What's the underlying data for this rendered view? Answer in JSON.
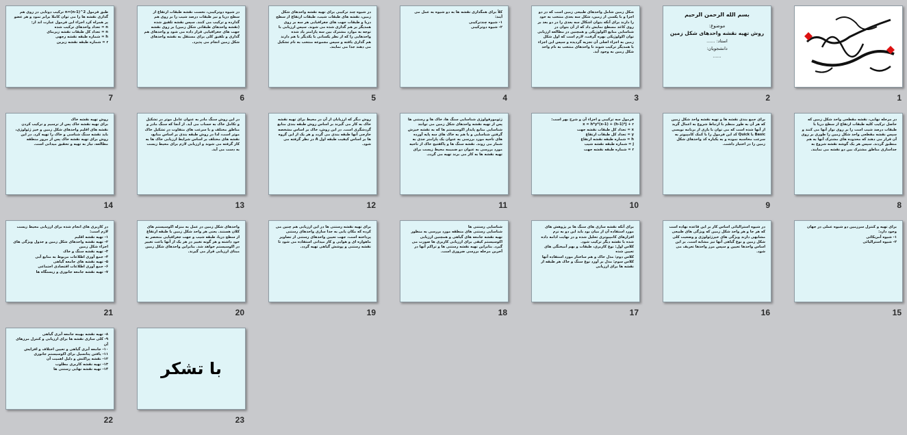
{
  "slides": [
    {
      "n": "1",
      "type": "calligraphy"
    },
    {
      "n": "2",
      "type": "title",
      "l1": "بسم الله الرحمن الرحیم",
      "l2": "موضوع:",
      "l3": "روش تهیه نقشه واحدهای شکل زمین",
      "l4": "استاد: ......",
      "l5": "دانشجویان:",
      "l6": "......"
    },
    {
      "n": "3",
      "type": "text",
      "text": "شکل زمین شامل واحدهای طبیعی زمین است که در دو اجزا و با یکسی از زمین، شکل سه بعدی منتخب به خود را دارند برای آنکه بتوان اشکال سه بعدی را در دو بعد بر روی کاغذ مسطح نمایش داد که از آن بتوان در شناسایی منابع اکولوژیکی و همچنین در مطالعه ارزیابی توان اکولوژیکی بهره گرفت، لازم است که اول شکل زمین به اجزاء اصلی آن تجزیه گردیده و سپس این اجزاء با همدیگر ترکیب شوند تا واحدهای منتخب به نام واحد شکل زمین به وجود آید."
    },
    {
      "n": "4",
      "type": "text",
      "text": "کلاً برای همگذاری نقشه ها به دو شیوه به عمل می آیند:\n۱- شیوه چندترکیبی\n۲- شیوه دوترکیبی"
    },
    {
      "n": "5",
      "type": "text",
      "text": "در شیوه چند ترکیبی برای تهیه نقشه واحدهای شکل زمین، نقشه های طبقات شیب، طبقات ارتفاع از سطح دریا و طبقات جهت های جغرافیایی هر سه بر روی همدیگر بر هم گذاری شده می شوند. سپس ارزیابی با توجه به موارد مشترک بین سه پارامتر یاد شده واحدهایی را که از نظر یکسانی با یکدیگر با هم دارند هم گذاری یافته و سپس مجموعه منتخب به نام تشکیل می دهند جدا می نمایند."
    },
    {
      "n": "6",
      "type": "text",
      "text": "در شیوه دوترکیبی، نخست نقشه طبقات ارتفاع از سطح دریا و نیز طبقات درصد شیب را بر روی هم گذارده و ترکیب می کنند. سپس نقشه تلفیق شده (نقشه واحدهای طبقاتی شکل زمین) بر روی نقشه جهت های جغرافیایی قرار داده می شود و واحدهای هم گذاری و تلفیق کلی برای مستقل به نقشه واحدهای شکل زمین انجام می پذیرد."
    },
    {
      "n": "7",
      "type": "text",
      "text": "طبق فرمول n=(n-1)^2 ترکیب دوتایی در روی هم گذاری نقشه ها را می توان کاملا برابر نمود و هر عضو پر همراه کرد اجزاء این فرمول عبارت اند از:\nn = تعداد واحدهای ترکیب شده\nn = تعداد کل طبقات نقشه زیربنای\nh = شماره طبقه نقشه رجهی\nr = شماره طبقه نقشه زیرین"
    },
    {
      "n": "8",
      "type": "text",
      "text": "در مرحله نهایی، نقشه مقطعی واحد شکل زمین که حاصل ترکیب کلیه طبقات ارتفاع از سطح دریا با طبقات درصد شیب است را بر روی نوار آنها می کنند و سپس نقشه مقطعی واحد شکل زمین را طوری بر روی آن قرار می دهند که محدوده های مشترک آنها به هم منطبق گردند. سپس هر یک گوشه نقشه شروع به جداسازی مناطق مشترک بین دو نقشه می نمایند."
    },
    {
      "n": "9",
      "type": "text",
      "text": "برای جمع بندی نقشه ها و تهیه نقشه واحد شکل زمین که هر آن به طور منظم با ارتباط شروع به اعمال گرید از آنها شده است که می توان با یاری از برنامه نویسی Basic یا Quick کد این فرمول را با کمک کامپیوتر به سرعت محاسبه نموده و به یکباره کد واحدهای شکل زمین را در اختیار داشت."
    },
    {
      "n": "10",
      "type": "text",
      "text": "فرمول سه ترکیبی و اجزاء آن و شرح بهر است:\nx = h*y*(x-1) + (h-1)*j + r\nx = تعداد کل طبقات نقشه جهت\ny = تعداد کل طبقات ارتفاع\nh = شماره طبقه نقشه ارتفاع\nj = شماره طبقه نقشه شیب\nr = شماره طبقه نقشه جهت"
    },
    {
      "n": "11",
      "type": "text",
      "text": "ژئومورفولوژی شناسایی سنگ ها، خاک ها و رستنی ها\nپس از تهیه نقشه واحدهای شکل زمین می توانند شناسایی منابع پایدار اکوسیستم ها که به نقشه خیزش گرفتن شناسایی و یا هم به خاک های سه پایه آورده های ناحیه مورد بررسی به عنوان یک پارامتر جدی به شمار می روند. نقشه سنگ ها و پاکفتیج خاک از ناحیه مورد بررسی به عنوان دو ضمیمه محیط زیست برای تهیه نقشه ها به کار می برند تهیه می گردد."
    },
    {
      "n": "12",
      "type": "text",
      "text": "روش دیگر که ارزیابان از آن در محیط برای تهیه نقشه خاک به کار می گیرند بر اساس روش طبقه بندی منابع گردشگری است. در این روش، خاک بر اساس مشخصه خارجی آنها طبقه بندی می گردد و هر یک از این گروه ها بر اساس کیفیت طبقه اول A در نظر گرفته می شود."
    },
    {
      "n": "13",
      "type": "text",
      "text": "در این روش سنگ مادر به عنوان عامل موثر در تشکیل و تکامل خاک به حساب می آید. از آنجا که سنگ مادر و مناطق مختلف و با سرعت های متفاوت در تشکیل خاک موثر است، لذا در روش طبقه بندی بر اساس منابع، نقشه های مختلف بر اساس شرایط ارزیابی خاک ها به کار گرفته می شوند و ارزیابی لازم برای محیط زیست به دست می آید."
    },
    {
      "n": "14",
      "type": "text",
      "text": "روش تهیه نقشه خاک\nبرای تهیه نقشه خاک پس از ترسیم و ترکیب کردن نقشه های اقلیم واحدهای شکل زمین و خیز ژئولوژی، باید نقشه سنگ شناسی و خاک را تهیه کرد. در این روش برای تهیه نقشه خاک پس از مرور منطقه مطالعه، نیاز به تهیه و تحقیق میدانی است."
    },
    {
      "n": "15",
      "type": "text",
      "text": "برای تهیه و کنترل سرزمین دو شیوه عملی در جهان وجود دارد:\n۱- شیوه آمریکائی\n۲- شیوه استرالیائی"
    },
    {
      "n": "16",
      "type": "text",
      "text": "در شیوه استرالیائی اساس کار بر این قاعده نهاده است که هر جا و هر واحد شکل زمین که ویژگی های طبیعی مشابهی دارند ویژگی های خیزژئولوژی و وضعیت کلی شکل زمین و نوع گیاهی آنها نیز مشابه است. بر این اساس واحدها تعیین و سپس مرز واحدها تعریف می شود."
    },
    {
      "n": "17",
      "type": "text",
      "text": "برای آنکه نقشه سازی های سنگ ها بر پژوهش های مورد استفاده آن از میان بود باید این دو به نرم افزارهای کامپیوتری تحلیل شده و در نهایت ادامه داده شده با نقشه دیگر ترکیب شود.\nکلاس اول: نوع کاربری، طبقات و بهم آمیختگی های تعیین شده\nکلاس دوم: مدل خاک و هم ساختار مورد استفاده آنها\nکلاس سوم: مدل بر آورد نوع سنگ و خاک هر طبقه از نقشه ها برای ارزیابی"
    },
    {
      "n": "18",
      "type": "text",
      "text": "شناسایی رستنی ها\nشناسایی رستنی های منطقه مورد بررسی به منظور تهیه نقشه جامعه های گیاهی و همچنین ارزیابی اکوسیستم کیفی برای ارزیابی کاربری ها صورت می گیرد. بنابراین تهیه نقشه رستنی ها و تراکم آنها در آخرین مرحله بررسی ضروری است."
    },
    {
      "n": "19",
      "type": "text",
      "text": "برای تهیه نقشه رستنی ها در این ارزیابی هم چنین می کرده که مکان یابی به جدا سازی واحدهای رستنی پرداخته است، جهت تعیین واحدهای رستنی از تصاویر ماهواره ای و هوایی و کار میدانی استفاده می شود تا نقشه رستنی و پوشش گیاهی تهیه گردد."
    },
    {
      "n": "20",
      "type": "text",
      "text": "واحدهای شکل زمین در عمل به منزله اکوسیستم های کلان هستند. یعنی هر واحد شکل زمین با طبقه ارتفاع از سطح دریا، طبقه شیب و جهت جغرافیایی منحصر به خود داشته و هر گونه تغییر در هر یک از آنها باعث تغییر در اکوسیستم خواهد شد. بنابراین واحدهای شکل زمین مبنای ارزیابی قرار می گیرند."
    },
    {
      "n": "21",
      "type": "text",
      "text": "در کاربری های انجام شده برای ارزیابی محیط زیست لازم است:\n۱- تهیه نقشه اقلیم\n۲- تهیه نقشه واحدهای شکل زمین و جدول ویژگی های اجزاء شکل زمین\n۳- تهیه نقشه سنگ و خاک\n۴- جمع آوری اطلاعات مربوط به منابع آبی\n۵- تهیه نقشه های جامعه گیاهی\n۶- جمع آوری اطلاعات اقتصادی اجتماعی\n۷- تهیه نقشه جامعه جانوری و زیستگاه ها"
    },
    {
      "n": "22",
      "type": "text",
      "text": "۸- تهیه نقشه بهینه جامعه آبزی گیاهی\n۹- کلی سازی نقشه ها برای ارزیابی و کنترل مرزهای آن\n۱۰- جامعه آبزی گیاهی و تعیین اختلاف و افزایش\n۱۱- یافتن پتانسیل برای اکوسیستم جانوری\n۱۲- نقشه پراکنش و دلیل اهمیت آن\n۱۳- تهیه نقشه کاربری مطلوب\n۱۴- تهیه نقشه نهایی رستنی ها"
    },
    {
      "n": "23",
      "type": "thanks",
      "text": "با تشکر"
    }
  ]
}
